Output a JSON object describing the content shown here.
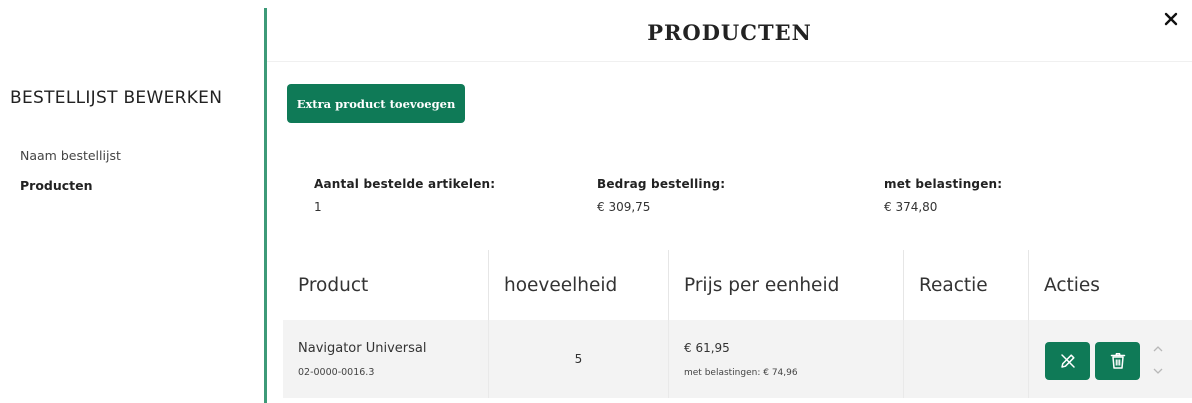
{
  "sidebar": {
    "title": "BESTELLIJST BEWERKEN",
    "items": [
      {
        "label": "Naam bestellijst"
      },
      {
        "label": "Producten"
      }
    ]
  },
  "header": {
    "title": "PRODUCTEN",
    "close_icon": "close-icon"
  },
  "toolbar": {
    "add_label": "Extra product toevoegen"
  },
  "summary": [
    {
      "label": "Aantal bestelde artikelen:",
      "value": "1"
    },
    {
      "label": "Bedrag bestelling:",
      "value": "€ 309,75"
    },
    {
      "label": "met belastingen:",
      "value": "€ 374,80"
    }
  ],
  "table": {
    "headers": [
      "Product",
      "hoeveelheid",
      "Prijs per eenheid",
      "Reactie",
      "Acties"
    ],
    "rows": [
      {
        "name": "Navigator Universal",
        "code": "02-0000-0016.3",
        "quantity": "5",
        "price": "€ 61,95",
        "price_tax": "met belastingen: € 74,96",
        "reaction": "",
        "actions": [
          "edit-icon",
          "trash-icon"
        ]
      }
    ]
  },
  "colors": {
    "accent": "#0f7a57",
    "divider": "#3d9a78",
    "row_bg": "#f3f3f3"
  }
}
